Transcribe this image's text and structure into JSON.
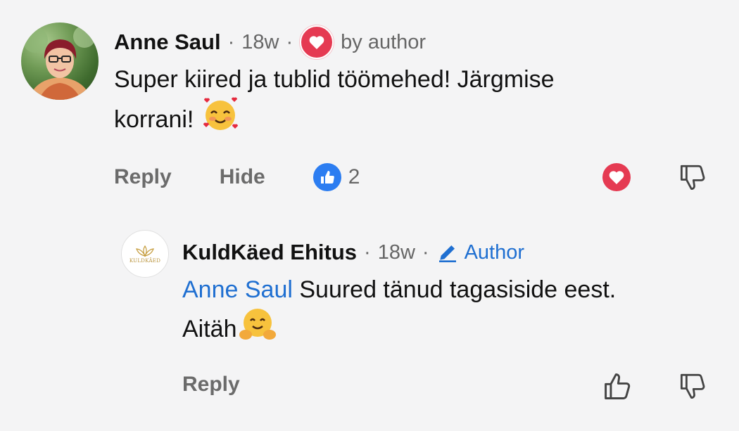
{
  "comment": {
    "author": "Anne Saul",
    "time": "18w",
    "liked_label": "by author",
    "text_line1": "Super kiired ja tublid töömehed! Järgmise",
    "text_line2": "korrani!",
    "emoji": "smiling-face-with-hearts",
    "actions": {
      "reply": "Reply",
      "hide": "Hide",
      "like_count": "2"
    }
  },
  "reply": {
    "author": "KuldKäed Ehitus",
    "time": "18w",
    "author_badge": "Author",
    "avatar_logo_text": "KULDKÄED",
    "mention": "Anne Saul",
    "text_line1": " Suured tänud tagasiside eest.",
    "text_line2": "Aitäh",
    "emoji": "hugging-face",
    "actions": {
      "reply": "Reply"
    }
  },
  "separator": "·",
  "colors": {
    "heart": "#e53a52",
    "like": "#2c7df1",
    "mention": "#1f6fd1"
  }
}
